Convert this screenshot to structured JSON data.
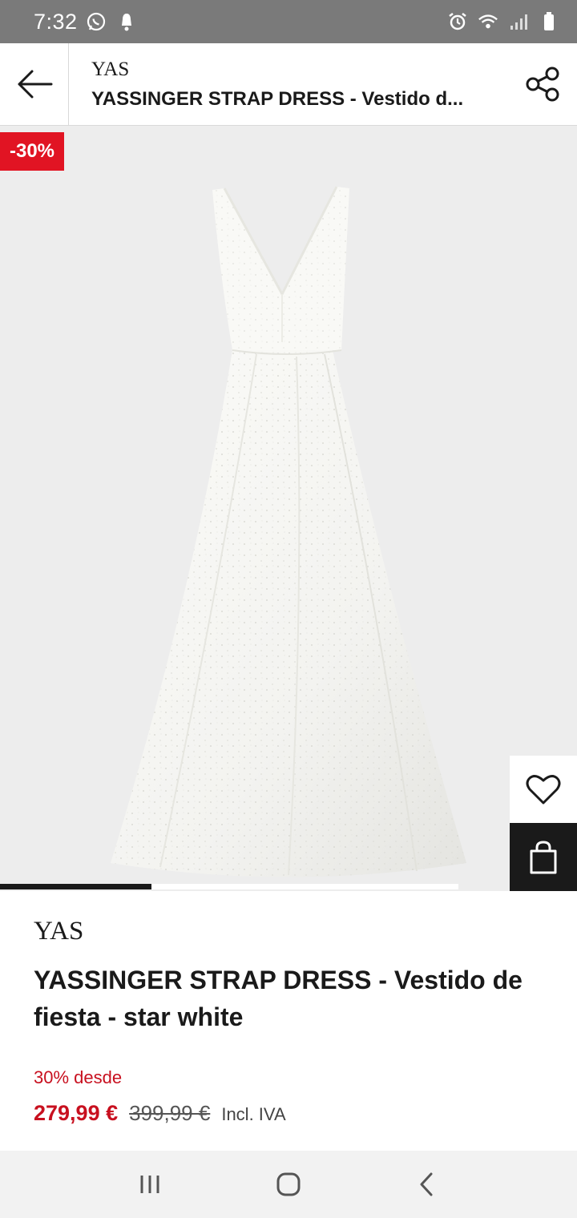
{
  "status_bar": {
    "time": "7:32",
    "left_icons": [
      "whatsapp-icon",
      "notification-icon"
    ],
    "right_icons": [
      "alarm-icon",
      "wifi-icon",
      "signal-icon",
      "battery-icon"
    ]
  },
  "header": {
    "brand": "YAS",
    "title": "YASSINGER STRAP DRESS - Vestido d..."
  },
  "gallery": {
    "discount_badge": "-30%",
    "image_description_icon": "dress-image",
    "progress": 0.33
  },
  "product": {
    "brand": "YAS",
    "title": "YASSINGER STRAP DRESS - Vestido de fiesta - star white",
    "discount_text": "30% desde",
    "price": "279,99 €",
    "original_price": "399,99 €",
    "vat_note": "Incl. IVA"
  },
  "nav": {
    "icons": [
      "recent-apps-icon",
      "home-icon",
      "back-icon"
    ]
  },
  "colors": {
    "accent_red": "#e11423",
    "price_red": "#c8101f",
    "dark": "#1a1a1a",
    "status_bar": "#7a7a7a"
  }
}
